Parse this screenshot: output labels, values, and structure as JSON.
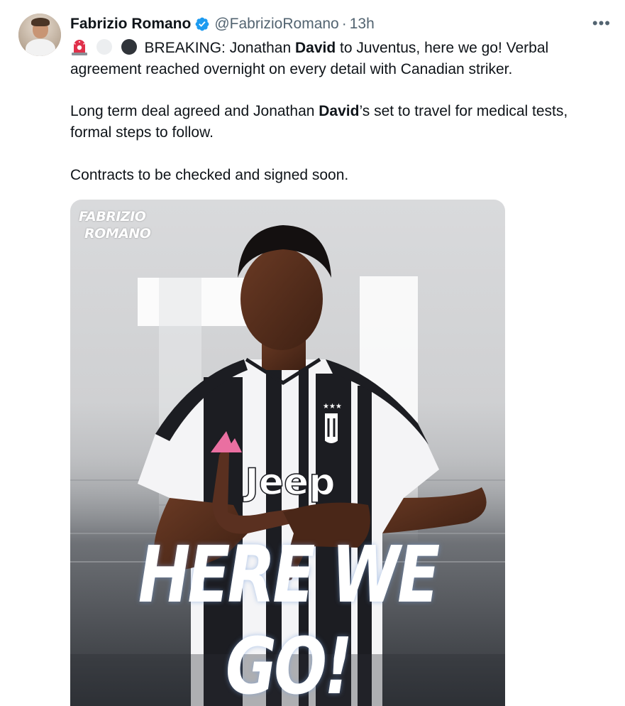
{
  "tweet": {
    "author_name": "Fabrizio Romano",
    "handle": "@FabrizioRomano",
    "separator": "·",
    "time": "13h",
    "more_icon": "•••",
    "icons": {
      "verified": "verified-badge-icon",
      "siren": "siren-emoji",
      "white_circle": "white-circle-emoji",
      "black_circle": "black-circle-emoji",
      "more": "more-options-icon"
    },
    "colors": {
      "verified": "#1d9bf0",
      "text": "#0f1419",
      "muted": "#536471"
    },
    "paragraph1": {
      "line1_a": "BREAKING: Jonathan ",
      "line1_bold": "David",
      "line1_b": " to Juventus, here we go! Verbal",
      "line2": "agreement reached overnight on every detail with Canadian striker."
    },
    "paragraph2": {
      "line1_a": "Long term deal agreed and Jonathan ",
      "line1_bold": "David",
      "line1_b": "’s set to travel for medical tests,",
      "line2": "formal steps to follow."
    },
    "paragraph3": "Contracts to be checked and signed soon."
  },
  "media": {
    "watermark_line1": "FABRIZIO",
    "watermark_line2": "ROMANO",
    "shirt_sponsor": "Jeep",
    "headline": "HERE WE GO!"
  }
}
